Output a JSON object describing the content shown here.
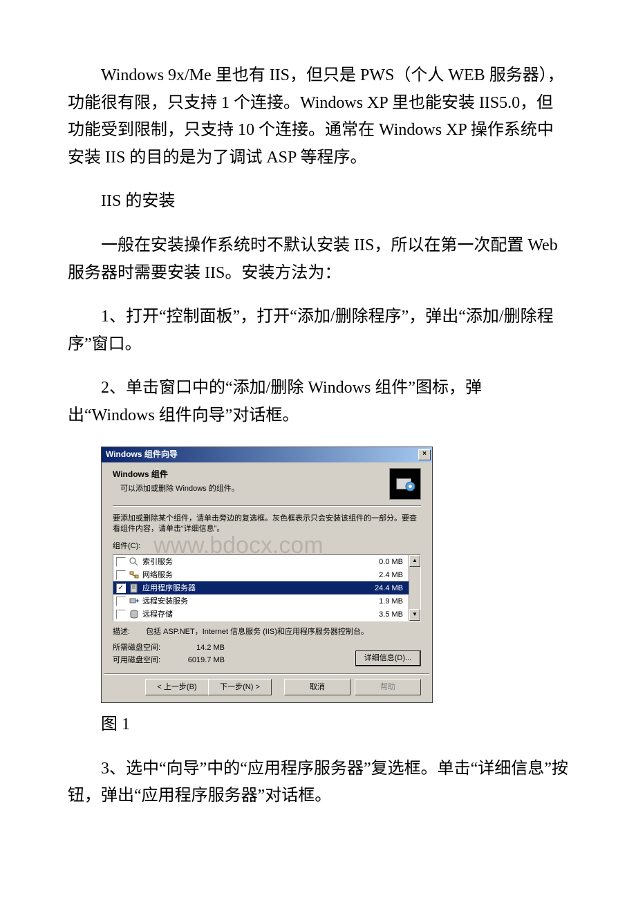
{
  "paragraphs": {
    "p1": "Windows 9x/Me 里也有 IIS，但只是 PWS（个人 WEB 服务器），功能很有限，只支持 1 个连接。Windows XP 里也能安装 IIS5.0，但功能受到限制，只支持 10 个连接。通常在 Windows XP 操作系统中安装 IIS 的目的是为了调试 ASP 等程序。",
    "p2": "IIS 的安装",
    "p3": "一般在安装操作系统时不默认安装 IIS，所以在第一次配置 Web 服务器时需要安装 IIS。安装方法为：",
    "p4": "1、打开“控制面板”，打开“添加/删除程序”，弹出“添加/删除程序”窗口。",
    "p5": "2、单击窗口中的“添加/删除 Windows 组件”图标，弹出“Windows 组件向导”对话框。",
    "caption": "图 1",
    "p6": "3、选中“向导”中的“应用程序服务器”复选框。单击“详细信息”按钮，弹出“应用程序服务器”对话框。"
  },
  "dialog": {
    "title": "Windows 组件向导",
    "close_x": "×",
    "heading": "Windows 组件",
    "sub_heading": "可以添加或删除 Windows 的组件。",
    "watermark": "www.bdocx.com",
    "instructions": "要添加或删除某个组件，请单击旁边的复选框。灰色框表示只会安装该组件的一部分。要查看组件内容，请单击“详细信息”。",
    "group_label": "组件(C):",
    "items": [
      {
        "checked": false,
        "label": "索引服务",
        "size": "0.0 MB"
      },
      {
        "checked": false,
        "label": "网络服务",
        "size": "2.4 MB"
      },
      {
        "checked": true,
        "label": "应用程序服务器",
        "size": "24.4 MB",
        "selected": true
      },
      {
        "checked": false,
        "label": "远程安装服务",
        "size": "1.9 MB"
      },
      {
        "checked": false,
        "label": "远程存储",
        "size": "3.5 MB"
      }
    ],
    "desc_label": "描述:",
    "desc_text": "包括 ASP.NET，Internet 信息服务 (IIS)和应用程序服务器控制台。",
    "space_required_label": "所需磁盘空间:",
    "space_required_value": "14.2 MB",
    "space_free_label": "可用磁盘空间:",
    "space_free_value": "6019.7 MB",
    "btn_details": "详细信息(D)...",
    "btn_back": "< 上一步(B)",
    "btn_next": "下一步(N) >",
    "btn_cancel": "取消",
    "btn_help": "帮助"
  }
}
